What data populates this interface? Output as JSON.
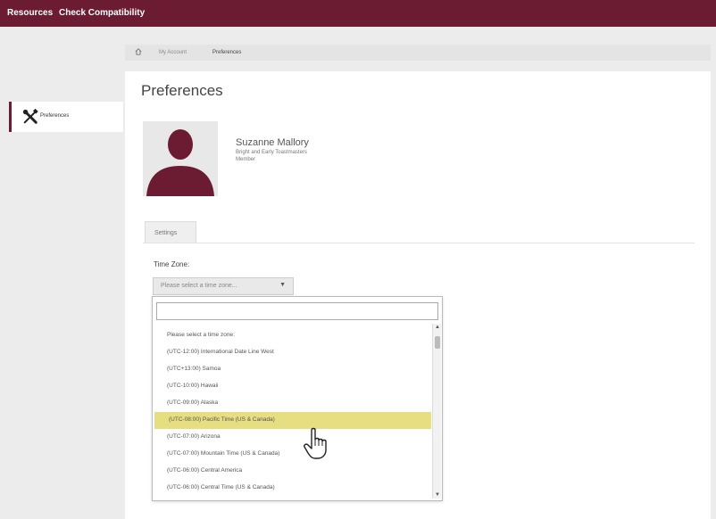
{
  "topbar": {
    "links": [
      "Resources",
      "Check Compatibility"
    ]
  },
  "breadcrumb": {
    "items": [
      "My Account",
      "Preferences"
    ]
  },
  "sidebar": {
    "items": [
      {
        "label": "Preferences",
        "icon": "tools-icon"
      }
    ]
  },
  "main": {
    "title": "Preferences",
    "profile": {
      "name": "Suzanne Mallory",
      "organization": "Bright and Early Toastmasters",
      "role": "Member"
    },
    "tabs": [
      {
        "label": "Settings",
        "active": true
      }
    ],
    "timezone": {
      "label": "Time Zone:",
      "selected": "Please select a time zone...",
      "search_value": "",
      "options": [
        "Please select a time zone:",
        "(UTC-12:00) International Date Line West",
        "(UTC+13:00) Samoa",
        "(UTC-10:00) Hawaii",
        "(UTC-09:00) Alaska",
        "(UTC-08:00) Pacific Time (US & Canada)",
        "(UTC-07:00) Arizona",
        "(UTC-07:00) Mountain Time (US & Canada)",
        "(UTC-06:00) Central America",
        "(UTC-06:00) Central Time (US & Canada)"
      ],
      "highlighted_option": "(UTC-08:00) Pacific Time (US & Canada)"
    }
  },
  "colors": {
    "brand": "#6b1b32",
    "highlight": "#e6de80"
  }
}
